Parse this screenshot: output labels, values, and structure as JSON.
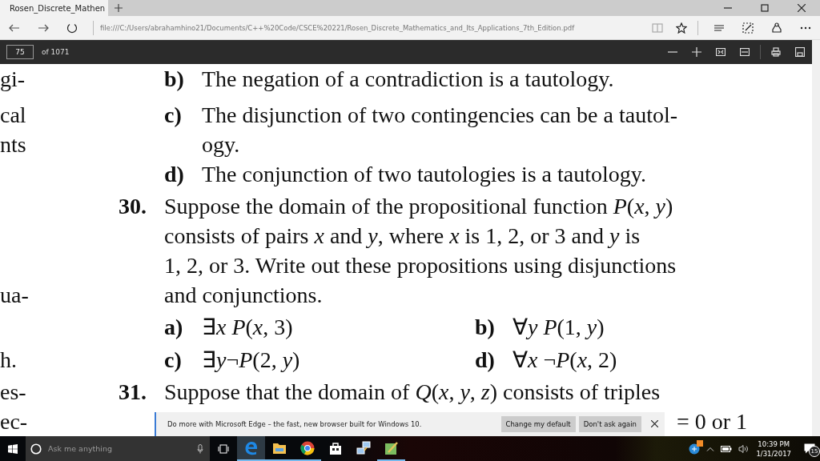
{
  "browser_tab": {
    "title": "Rosen_Discrete_Mathen"
  },
  "address_bar": {
    "url": "file:///C:/Users/abrahamhino21/Documents/C++%20Code/CSCE%20221/Rosen_Discrete_Mathematics_and_Its_Applications_7th_Edition.pdf"
  },
  "pdf_toolbar": {
    "page": "75",
    "page_count": "of 1071"
  },
  "document": {
    "rows": [
      {
        "kind": "item",
        "margin": "gi-",
        "label": "b)",
        "text": "The negation of a contradiction is a tautology."
      },
      {
        "kind": "item",
        "margin": "cal",
        "label": "c)",
        "text": "The disjunction of two contingencies can be a tautol-"
      },
      {
        "kind": "cont",
        "margin": "nts",
        "text": "ogy."
      },
      {
        "kind": "item",
        "label": "d)",
        "text": "The conjunction of two tautologies is a tautology."
      },
      {
        "kind": "problem",
        "margin": "ua-",
        "number": "30.",
        "text": "Suppose the domain of the propositional function *P*(*x*, *y*)\nconsists of pairs *x* and *y*, where *x* is 1, 2, or 3 and *y* is\n1, 2, or 3. Write out these propositions using disjunctions\nand conjunctions."
      },
      {
        "kind": "parts",
        "parts": [
          {
            "label": "a)",
            "text": "∃*x P*(*x*, 3)"
          },
          {
            "label": "b)",
            "text": "∀*y P*(1, *y*)"
          }
        ]
      },
      {
        "kind": "parts",
        "margin": "h.",
        "parts": [
          {
            "label": "c)",
            "text": "∃*y*¬*P*(2, *y*)"
          },
          {
            "label": "d)",
            "text": "∀*x* ¬*P*(*x*, 2)"
          }
        ]
      },
      {
        "kind": "problem",
        "margin": "es-",
        "number": "31.",
        "text": "Suppose that the domain of *Q*(*x*, *y*, *z*) consists of triples"
      },
      {
        "kind": "fragment",
        "margin": "ec-",
        "text": "= 0 or 1"
      }
    ]
  },
  "notification": {
    "message": "Do more with Microsoft Edge – the fast, new browser built for Windows 10.",
    "buttons": [
      "Change my default",
      "Don't ask again"
    ]
  },
  "taskbar": {
    "search_placeholder": "Ask me anything",
    "apps": [
      {
        "kind": "edge",
        "running": true,
        "active": true
      },
      {
        "kind": "folder",
        "running": true,
        "active": false
      },
      {
        "kind": "chrome",
        "running": true,
        "active": false
      },
      {
        "kind": "store",
        "running": false,
        "active": false
      },
      {
        "kind": "network",
        "running": false,
        "active": false
      },
      {
        "kind": "editor",
        "running": true,
        "active": false
      }
    ],
    "time": "10:39 PM",
    "date": "1/31/2017",
    "notification_count": "15"
  }
}
